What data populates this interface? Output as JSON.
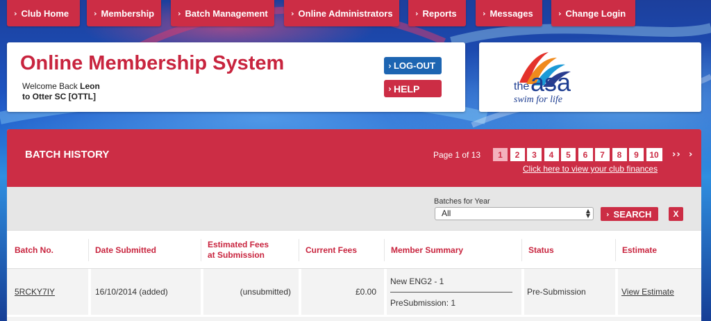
{
  "nav": {
    "items": [
      {
        "label": "Club Home"
      },
      {
        "label": "Membership"
      },
      {
        "label": "Batch Management"
      },
      {
        "label": "Online Administrators"
      },
      {
        "label": "Reports"
      },
      {
        "label": "Messages"
      },
      {
        "label": "Change Login"
      }
    ]
  },
  "header": {
    "app_title": "Online Membership System",
    "welcome_prefix": "Welcome Back",
    "user_name": "Leon",
    "club_line": "to Otter SC [OTTL]",
    "logout_label": "LOG-OUT",
    "help_label": "HELP"
  },
  "logo": {
    "word_the": "the",
    "word_asa": "asa",
    "tagline": "swim for life"
  },
  "batch": {
    "title": "BATCH HISTORY",
    "page_info": "Page 1 of 13",
    "pages": [
      "1",
      "2",
      "3",
      "4",
      "5",
      "6",
      "7",
      "8",
      "9",
      "10"
    ],
    "active_page": "1",
    "next_label": "››",
    "last_label": "›",
    "finance_link": "Click here to view your club finances"
  },
  "filter": {
    "label": "Batches for Year",
    "year_value": "All",
    "search_label": "SEARCH",
    "clear_label": "X"
  },
  "table": {
    "columns": {
      "batch_no": "Batch No.",
      "date_submitted": "Date Submitted",
      "est_fees_1": "Estimated Fees",
      "est_fees_2": "at Submission",
      "current_fees": "Current Fees",
      "member_summary": "Member Summary",
      "status": "Status",
      "estimate": "Estimate"
    },
    "rows": [
      {
        "batch_no": "5RCKY7IY",
        "date_submitted": "16/10/2014 (added)",
        "est_fees": "(unsubmitted)",
        "current_fees": "£0.00",
        "summary_1": "New ENG2 - 1",
        "summary_2": "PreSubmission: 1",
        "status": "Pre-Submission",
        "estimate": "View Estimate"
      }
    ]
  },
  "colors": {
    "accent": "#cc2d45",
    "logout_blue": "#1d65b2"
  }
}
